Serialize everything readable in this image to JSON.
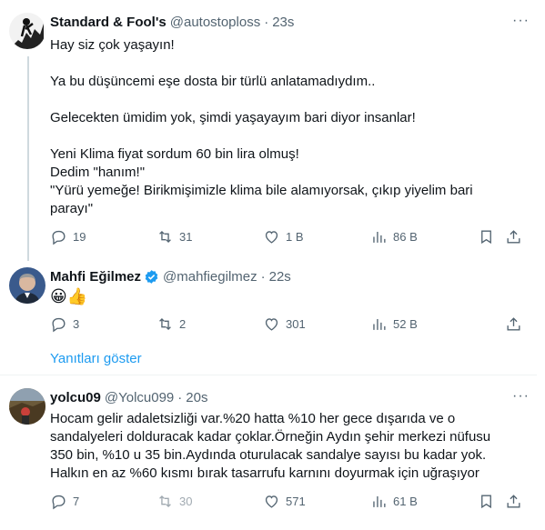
{
  "tweets": [
    {
      "name": "Standard & Fool's",
      "handle": "@autostoploss",
      "time": "23s",
      "text": "Hay siz çok yaşayın!\n\nYa bu düşüncemi eşe dosta bir türlü anlatamadıydım..\n\nGelecekten ümidim yok, şimdi yaşayayım bari diyor insanlar!\n\nYeni Klima fiyat sordum 60 bin lira olmuş!\nDedim \"hanım!\"\n\"Yürü yemeğe! Birikmişimizle klima bile alamıyorsak, çıkıp yiyelim bari parayı\"",
      "replies": "19",
      "retweets": "31",
      "likes": "1 B",
      "views": "86 B"
    },
    {
      "name": "Mahfi Eğilmez",
      "handle": "@mahfiegilmez",
      "time": "22s",
      "text": "😀👍",
      "replies": "3",
      "retweets": "2",
      "likes": "301",
      "views": "52 B",
      "verified": true
    },
    {
      "name": "yolcu09",
      "handle": "@Yolcu099",
      "time": "20s",
      "text": "Hocam gelir adaletsizliği var.%20 hatta %10 her gece dışarıda ve o sandalyeleri dolduracak kadar çoklar.Örneğin Aydın şehir merkezi nüfusu 350 bin, %10 u 35 bin.Aydında oturulacak sandalye sayısı bu kadar yok. Halkın en az %60 kısmı bırak tasarrufu karnını doyurmak için uğraşıyor",
      "replies": "7",
      "retweets": "30",
      "likes": "571",
      "views": "61 B"
    }
  ],
  "show_replies": "Yanıtları göster",
  "more_icon": "···",
  "colors": {
    "link": "#1d9bf0",
    "muted": "#536471",
    "verified": "#1d9bf0"
  }
}
